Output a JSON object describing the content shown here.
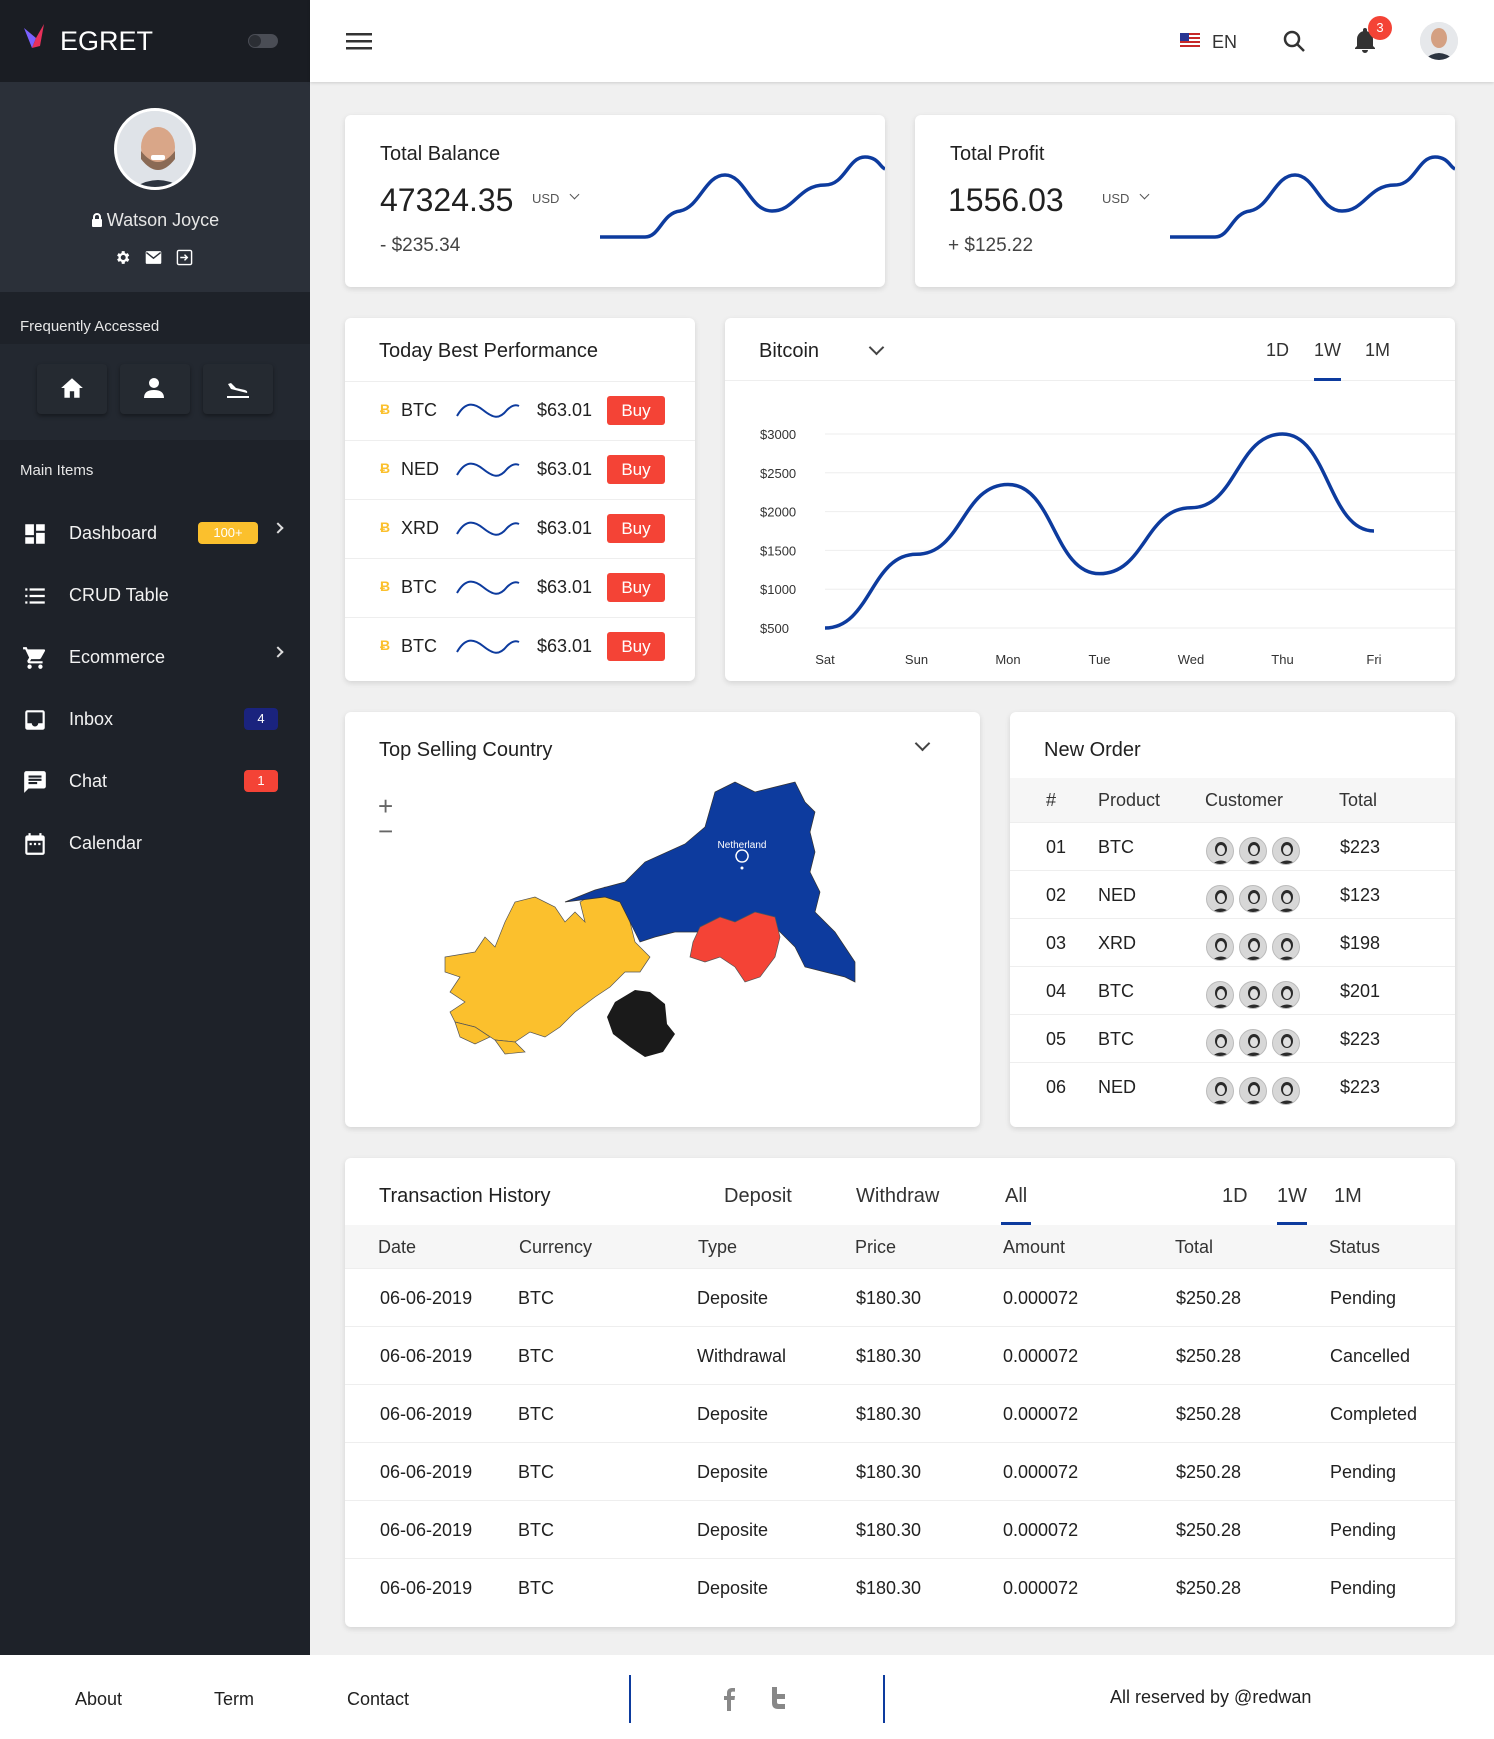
{
  "brand": {
    "name": "EGRET"
  },
  "profile": {
    "name": "Watson Joyce"
  },
  "sidebar": {
    "frequently_title": "Frequently Accessed",
    "main_title": "Main Items",
    "items": [
      {
        "label": "Dashboard",
        "badge": "100+"
      },
      {
        "label": "CRUD Table"
      },
      {
        "label": "Ecommerce"
      },
      {
        "label": "Inbox",
        "badge": "4"
      },
      {
        "label": "Chat",
        "badge": "1"
      },
      {
        "label": "Calendar"
      }
    ]
  },
  "header": {
    "language": "EN",
    "notification_count": "3"
  },
  "balance": {
    "title": "Total Balance",
    "value": "47324.35",
    "currency": "USD",
    "change": "- $235.34"
  },
  "profit": {
    "title": "Total Profit",
    "value": "1556.03",
    "currency": "USD",
    "change": "+ $125.22"
  },
  "performance": {
    "title": "Today Best Performance",
    "buy_label": "Buy",
    "rows": [
      {
        "symbol": "BTC",
        "price": "$63.01"
      },
      {
        "symbol": "NED",
        "price": "$63.01"
      },
      {
        "symbol": "XRD",
        "price": "$63.01"
      },
      {
        "symbol": "BTC",
        "price": "$63.01"
      },
      {
        "symbol": "BTC",
        "price": "$63.01"
      }
    ]
  },
  "bitcoin": {
    "title": "Bitcoin",
    "ranges": [
      "1D",
      "1W",
      "1M"
    ],
    "active_range": "1W"
  },
  "chart_data": {
    "type": "line",
    "x": [
      "Sat",
      "Sun",
      "Mon",
      "Tue",
      "Wed",
      "Thu",
      "Fri"
    ],
    "values": [
      500,
      1450,
      2350,
      1200,
      2050,
      3000,
      1750
    ],
    "y_ticks": [
      "$3000",
      "$2500",
      "$2000",
      "$1500",
      "$1000",
      "$500"
    ],
    "ylim": [
      500,
      3000
    ],
    "color": "#0d3b9e"
  },
  "country": {
    "title": "Top Selling Country",
    "zoom_in": "+",
    "zoom_out": "−",
    "label": "Netherland"
  },
  "orders": {
    "title": "New Order",
    "headers": [
      "#",
      "Product",
      "Customer",
      "Total"
    ],
    "rows": [
      {
        "id": "01",
        "product": "BTC",
        "total": "$223"
      },
      {
        "id": "02",
        "product": "NED",
        "total": "$123"
      },
      {
        "id": "03",
        "product": "XRD",
        "total": "$198"
      },
      {
        "id": "04",
        "product": "BTC",
        "total": "$201"
      },
      {
        "id": "05",
        "product": "BTC",
        "total": "$223"
      },
      {
        "id": "06",
        "product": "NED",
        "total": "$223"
      }
    ]
  },
  "transactions": {
    "title": "Transaction History",
    "tabs": [
      "Deposit",
      "Withdraw",
      "All"
    ],
    "ranges": [
      "1D",
      "1W",
      "1M"
    ],
    "headers": [
      "Date",
      "Currency",
      "Type",
      "Price",
      "Amount",
      "Total",
      "Status"
    ],
    "rows": [
      [
        "06-06-2019",
        "BTC",
        "Deposite",
        "$180.30",
        "0.000072",
        "$250.28",
        "Pending"
      ],
      [
        "06-06-2019",
        "BTC",
        "Withdrawal",
        "$180.30",
        "0.000072",
        "$250.28",
        "Cancelled"
      ],
      [
        "06-06-2019",
        "BTC",
        "Deposite",
        "$180.30",
        "0.000072",
        "$250.28",
        "Completed"
      ],
      [
        "06-06-2019",
        "BTC",
        "Deposite",
        "$180.30",
        "0.000072",
        "$250.28",
        "Pending"
      ],
      [
        "06-06-2019",
        "BTC",
        "Deposite",
        "$180.30",
        "0.000072",
        "$250.28",
        "Pending"
      ],
      [
        "06-06-2019",
        "BTC",
        "Deposite",
        "$180.30",
        "0.000072",
        "$250.28",
        "Pending"
      ]
    ]
  },
  "footer": {
    "about": "About",
    "term": "Term",
    "contact": "Contact",
    "copyright": "All reserved by @redwan"
  },
  "colors": {
    "sidebar": "#1e2229",
    "accent": "#0d3b9e",
    "buy": "#f44336",
    "badge_yellow": "#fbc02d"
  }
}
